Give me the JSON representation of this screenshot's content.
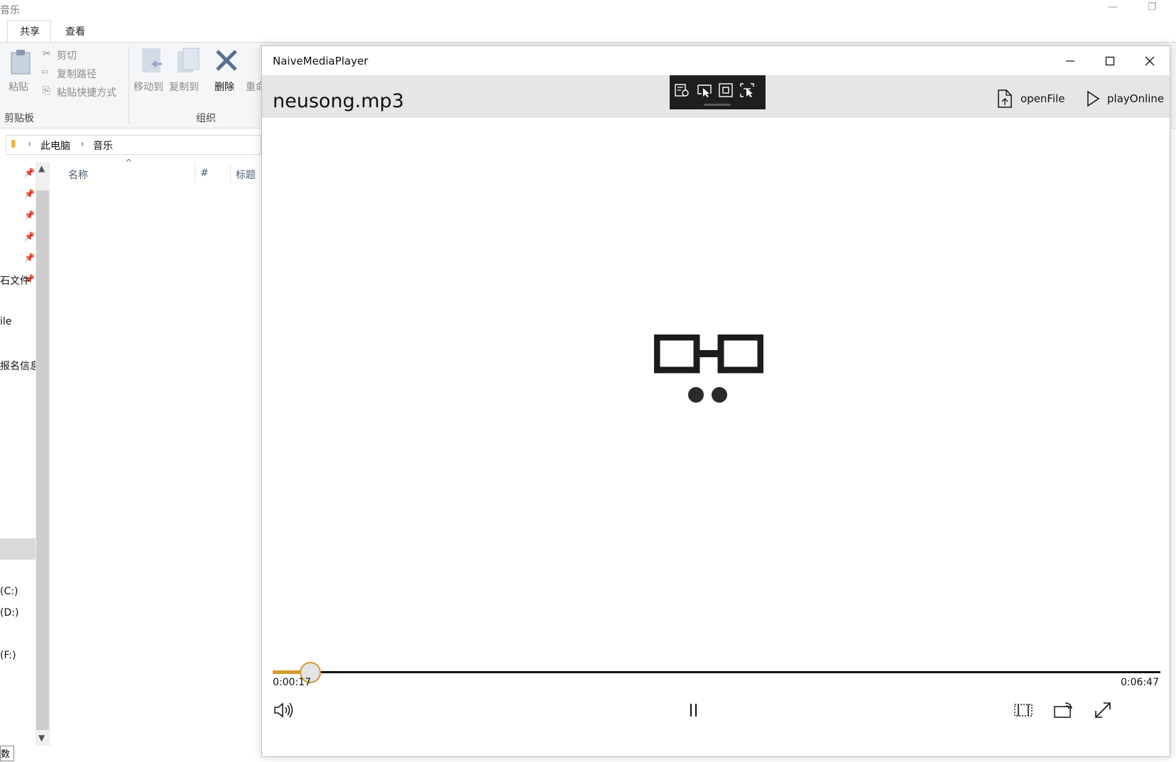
{
  "explorer": {
    "title": "音乐",
    "tabs": [
      "共享",
      "查看"
    ],
    "ribbon": {
      "paste": "粘贴",
      "cut": "剪切",
      "copy_path": "复制路径",
      "paste_shortcut": "粘贴快捷方式",
      "move_to": "移动到",
      "copy_to": "复制到",
      "delete": "删除",
      "rename": "重命",
      "group_clipboard": "剪贴板",
      "group_organize": "组织"
    },
    "breadcrumb": [
      "此电脑",
      "音乐"
    ],
    "columns": [
      "名称",
      "#",
      "标题"
    ],
    "nav_items": [
      "石文件",
      "ile",
      "报名信息"
    ],
    "drives": [
      "(C:)",
      "(D:)",
      "(F:)"
    ],
    "status_tip": "数"
  },
  "player": {
    "app_title": "NaiveMediaPlayer",
    "file_name": "neusong.mp3",
    "open_file_label": "openFile",
    "play_online_label": "playOnline",
    "current_time": "0:00:17",
    "total_time": "0:06:47",
    "progress_fraction": 0.042,
    "accent_color": "#d69a2d"
  }
}
